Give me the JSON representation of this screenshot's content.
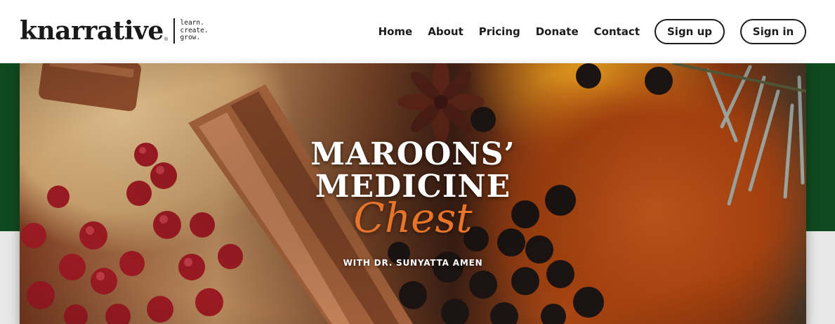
{
  "brand": {
    "name": "knarrative",
    "reg_mark": "®",
    "tagline": [
      "learn.",
      "create.",
      "grow."
    ]
  },
  "nav": {
    "links": [
      "Home",
      "About",
      "Pricing",
      "Donate",
      "Contact"
    ],
    "signup_label": "Sign up",
    "signin_label": "Sign in"
  },
  "hero": {
    "title_line1": "MAROONS’",
    "title_line2": "MEDICINE",
    "title_script": "Chest",
    "subtitle": "WITH DR. SUNYATTA AMEN"
  },
  "colors": {
    "header_bg": "#ffffff",
    "green_band": "#0f4a1f",
    "gray_band": "#e7e7e7",
    "script_accent": "#e8742a",
    "text_dark": "#1c1c1c"
  }
}
